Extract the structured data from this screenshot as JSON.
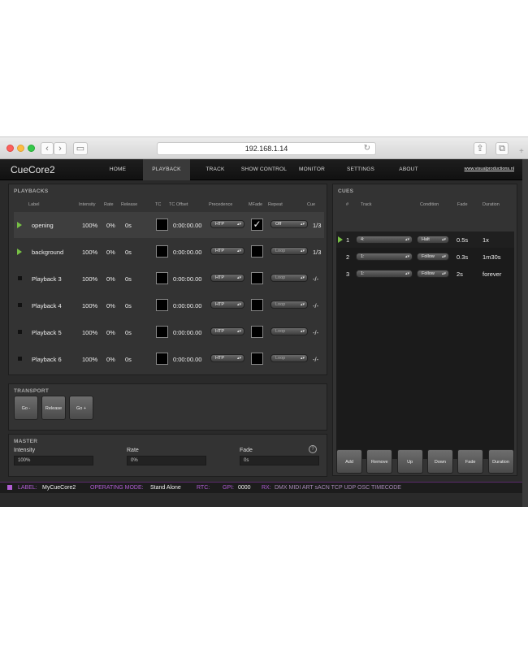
{
  "browser": {
    "url": "192.168.1.14"
  },
  "app": {
    "brand": "CueCore2",
    "link": "www.visualproductions.nl"
  },
  "nav": [
    "HOME",
    "PLAYBACK",
    "TRACK",
    "SHOW CONTROL",
    "MONITOR",
    "SETTINGS",
    "ABOUT"
  ],
  "nav_active": "PLAYBACK",
  "playbacks": {
    "title": "PLAYBACKS",
    "columns": [
      "Label",
      "Intensity",
      "Rate",
      "Release",
      "TC",
      "TC Offset",
      "Precedence",
      "MFade",
      "Repeat",
      "Cue"
    ],
    "rows": [
      {
        "label": "opening",
        "intensity": "100%",
        "rate": "0%",
        "release": "0s",
        "tc_offset": "0:00:00.00",
        "precedence": "HTP",
        "mfade": true,
        "repeat": "Off",
        "cue": "1/3",
        "state": "playing"
      },
      {
        "label": "background",
        "intensity": "100%",
        "rate": "0%",
        "release": "0s",
        "tc_offset": "0:00:00.00",
        "precedence": "HTP",
        "mfade": false,
        "repeat": "Loop",
        "cue": "1/3",
        "state": "playing"
      },
      {
        "label": "Playback 3",
        "intensity": "100%",
        "rate": "0%",
        "release": "0s",
        "tc_offset": "0:00:00.00",
        "precedence": "HTP",
        "mfade": false,
        "repeat": "Loop",
        "cue": "-/-",
        "state": "stopped"
      },
      {
        "label": "Playback 4",
        "intensity": "100%",
        "rate": "0%",
        "release": "0s",
        "tc_offset": "0:00:00.00",
        "precedence": "HTP",
        "mfade": false,
        "repeat": "Loop",
        "cue": "-/-",
        "state": "stopped"
      },
      {
        "label": "Playback 5",
        "intensity": "100%",
        "rate": "0%",
        "release": "0s",
        "tc_offset": "0:00:00.00",
        "precedence": "HTP",
        "mfade": false,
        "repeat": "Loop",
        "cue": "-/-",
        "state": "stopped"
      },
      {
        "label": "Playback 6",
        "intensity": "100%",
        "rate": "0%",
        "release": "0s",
        "tc_offset": "0:00:00.00",
        "precedence": "HTP",
        "mfade": false,
        "repeat": "Loop",
        "cue": "-/-",
        "state": "stopped"
      }
    ]
  },
  "cues": {
    "title": "CUES",
    "columns": [
      "#",
      "Track",
      "Condition",
      "Fade",
      "Duration"
    ],
    "rows": [
      {
        "num": "1",
        "track": "4:",
        "condition": "Halt",
        "fade": "0.5s",
        "duration": "1x",
        "state": "active"
      },
      {
        "num": "2",
        "track": "1:",
        "condition": "Follow",
        "fade": "0.3s",
        "duration": "1m30s",
        "state": "selected"
      },
      {
        "num": "3",
        "track": "1:",
        "condition": "Follow",
        "fade": "2s",
        "duration": "forever",
        "state": "normal"
      }
    ],
    "buttons": [
      "Add",
      "Remove",
      "Up",
      "Down",
      "Fade",
      "Duration"
    ]
  },
  "transport": {
    "title": "TRANSPORT",
    "buttons": [
      "Go -",
      "Release",
      "Go +"
    ]
  },
  "master": {
    "title": "MASTER",
    "intensity_label": "Intensity",
    "intensity_value": "100%",
    "rate_label": "Rate",
    "rate_value": "0%",
    "fade_label": "Fade",
    "fade_value": "0s",
    "help": "?"
  },
  "status": {
    "label_key": "LABEL:",
    "label_val": "MyCueCore2",
    "mode_key": "OPERATING MODE:",
    "mode_val": "Stand Alone",
    "rtc_key": "RTC:",
    "gpi_key": "GPI:",
    "gpi_val": "0000",
    "rx_key": "RX:",
    "rx_val": "DMX MIDI ART sACN TCP UDP OSC TIMECODE"
  },
  "colors": {
    "accent": "#b05dd4",
    "play": "#77c045",
    "bg": "#2a2a2a"
  }
}
